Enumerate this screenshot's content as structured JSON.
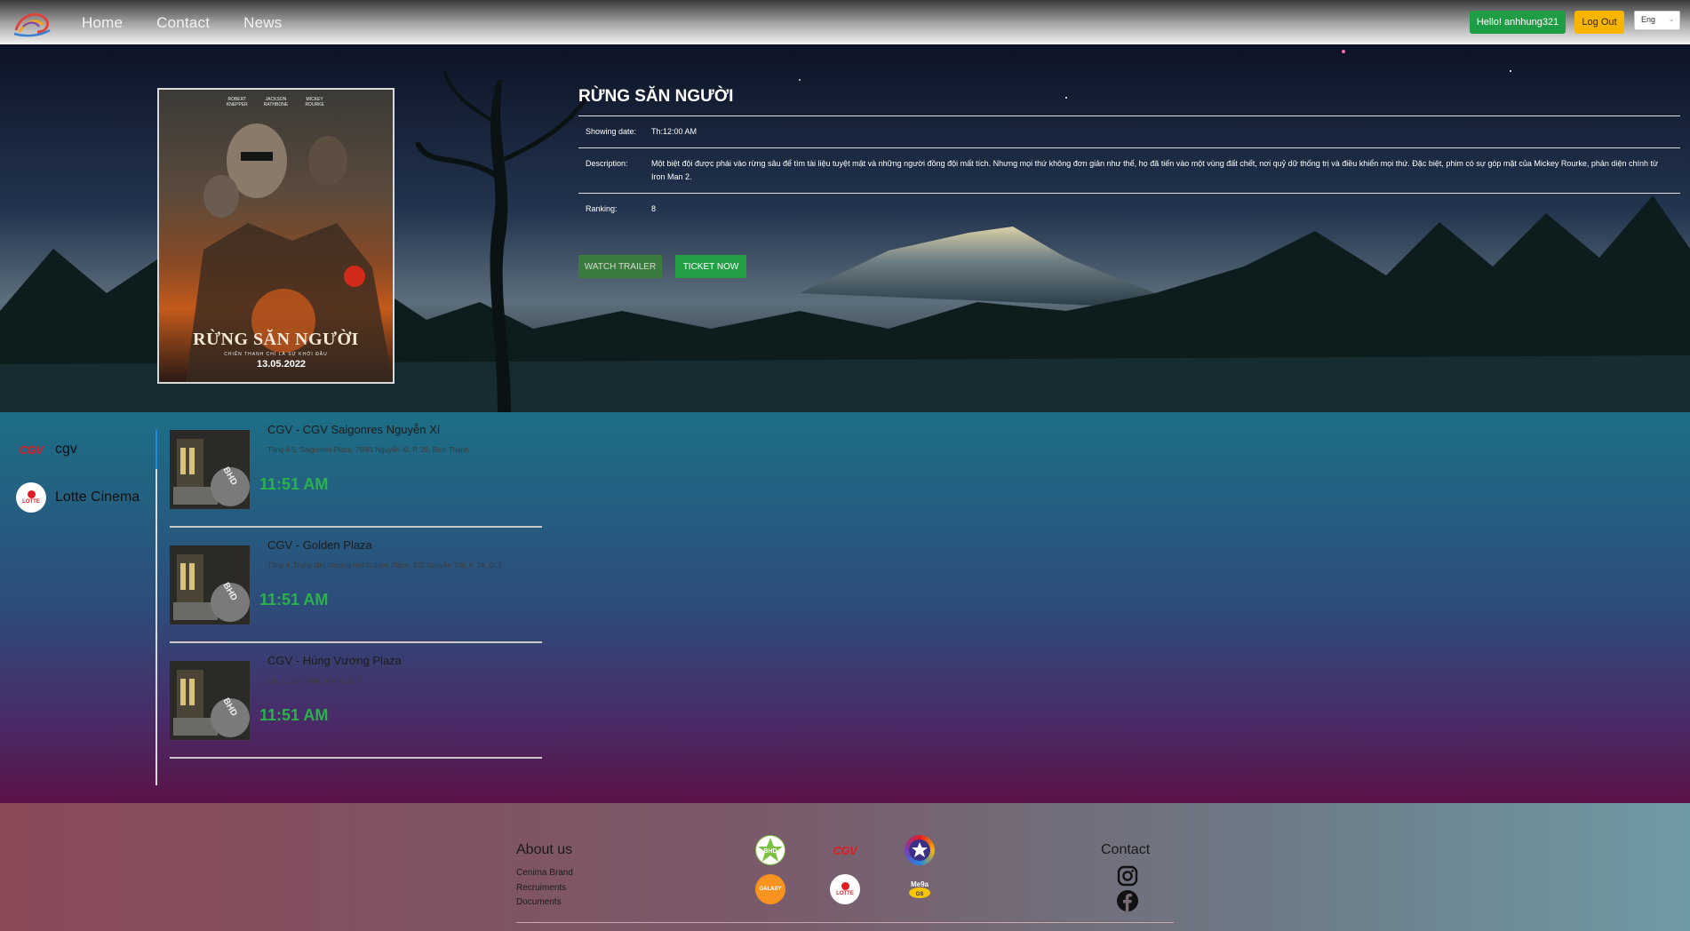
{
  "header": {
    "nav": [
      "Home",
      "Contact",
      "News"
    ],
    "hello_label": "Hello! anhhung321",
    "logout_label": "Log Out",
    "lang_value": "Eng"
  },
  "movie": {
    "title": "RỪNG SĂN NGƯỜI",
    "poster": {
      "cast": [
        "ROBERT KNEPPER",
        "JACKSON RATHBONE",
        "MICKEY ROURKE"
      ],
      "title": "RỪNG SĂN NGƯỜI",
      "tagline": "CHIẾN THANH CHỈ LÀ SỰ KHỞI ĐẦU",
      "date": "13.05.2022"
    },
    "info": [
      {
        "label": "Showing date:",
        "value": "Th:12:00 AM"
      },
      {
        "label": "Description:",
        "value": "Một biệt đội được phái vào rừng sâu để tìm tài liệu tuyệt mật và những người đồng đội mất tích. Nhưng mọi thứ không đơn giản như thế, họ đã tiến vào một vùng đất chết, nơi quỷ dữ thống trị và điều khiển mọi thứ. Đặc biệt, phim có sự góp mặt của Mickey Rourke, phản diện chính từ Iron Man 2."
      },
      {
        "label": "Ranking:",
        "value": "8"
      }
    ],
    "trailer_label": "WATCH TRAILER",
    "ticket_label": "TICKET NOW"
  },
  "brands": [
    {
      "name": "cgv",
      "logo_text": "CGV",
      "icon": "cgv-logo-icon"
    },
    {
      "name": "Lotte Cinema",
      "logo_text": "LOTTE",
      "icon": "lotte-logo-icon"
    }
  ],
  "cinemas": [
    {
      "name": "CGV - CGV Saigonres Nguyễn Xí",
      "address": "Tầng 4-5, Saigonres Plaza, 79/81 Nguyễn Xí, P. 26, Bình Thạnh",
      "time": "11:51 AM",
      "thumb_text": "BHD"
    },
    {
      "name": "CGV - Golden Plaza",
      "address": "Tầng 4, Trung tâm thương mại Golden Plaza, 922 Nguyễn Trãi, P. 14, Q. 5",
      "time": "11:51 AM",
      "thumb_text": "BHD"
    },
    {
      "name": "CGV - Hùng Vương Plaza",
      "address": "Lầu 7, 126 Hùng Vương, Q. 5",
      "time": "11:51 AM",
      "thumb_text": "BHD"
    }
  ],
  "footer": {
    "about_title": "About us",
    "about_links": [
      "Cenima Brand",
      "Recruiments",
      "Documents"
    ],
    "partners": [
      "BHD STAR",
      "CGV",
      "CINESTAR",
      "GALAXY CINEMA",
      "LOTTE",
      "MEGA GS"
    ],
    "contact_title": "Contact",
    "social_icons": [
      "instagram-icon",
      "facebook-icon"
    ]
  },
  "colors": {
    "hello_bg": "#1f9d44",
    "logout_bg": "#f7b500",
    "time_green": "#2bb24c",
    "cgv_red": "#e31b23"
  }
}
